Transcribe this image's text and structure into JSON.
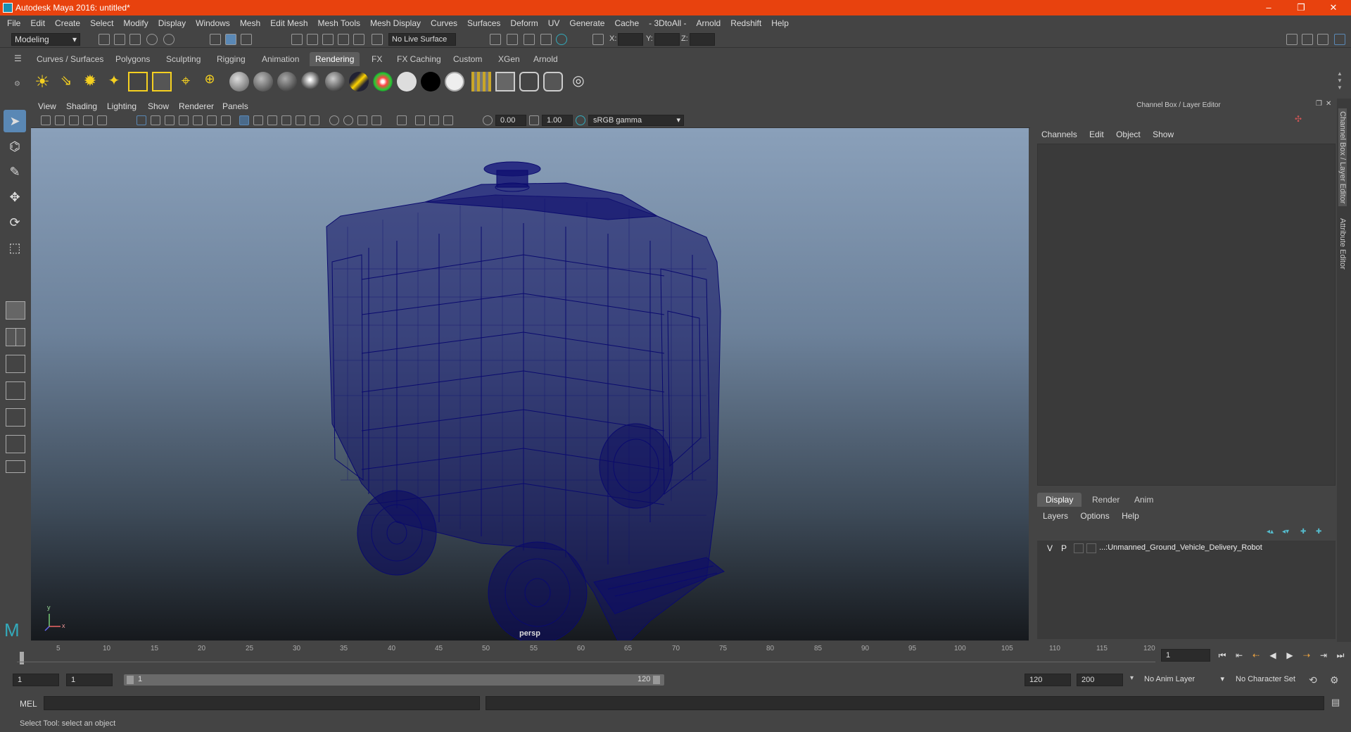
{
  "window": {
    "title": "Autodesk Maya 2016: untitled*",
    "minimize": "–",
    "maximize": "❐",
    "close": "✕"
  },
  "menubar": [
    "File",
    "Edit",
    "Create",
    "Select",
    "Modify",
    "Display",
    "Windows",
    "Mesh",
    "Edit Mesh",
    "Mesh Tools",
    "Mesh Display",
    "Curves",
    "Surfaces",
    "Deform",
    "UV",
    "Generate",
    "Cache",
    "- 3DtoAll -",
    "Arnold",
    "Redshift",
    "Help"
  ],
  "statusline": {
    "menuset": "Modeling",
    "live_surface": "No Live Surface",
    "x_label": "X:",
    "y_label": "Y:",
    "z_label": "Z:"
  },
  "shelf_tabs": [
    "Curves / Surfaces",
    "Polygons",
    "Sculpting",
    "Rigging",
    "Animation",
    "Rendering",
    "FX",
    "FX Caching",
    "Custom",
    "XGen",
    "Arnold"
  ],
  "active_shelf_tab": "Rendering",
  "viewport": {
    "menus": [
      "View",
      "Shading",
      "Lighting",
      "Show",
      "Renderer",
      "Panels"
    ],
    "exposure": "0.00",
    "gamma": "1.00",
    "color_space": "sRGB gamma",
    "camera": "persp",
    "axis_y": "y",
    "axis_x": "x"
  },
  "channel_box": {
    "title": "Channel Box / Layer Editor",
    "menus": [
      "Channels",
      "Edit",
      "Object",
      "Show"
    ]
  },
  "layer_editor": {
    "tabs": [
      "Display",
      "Render",
      "Anim"
    ],
    "active_tab": "Display",
    "menus": [
      "Layers",
      "Options",
      "Help"
    ],
    "layer": {
      "v": "V",
      "p": "P",
      "name": "...:Unmanned_Ground_Vehicle_Delivery_Robot"
    }
  },
  "side_tabs": [
    "Channel Box / Layer Editor",
    "Attribute Editor"
  ],
  "timeline": {
    "ticks": [
      "1",
      "5",
      "10",
      "15",
      "20",
      "25",
      "30",
      "35",
      "40",
      "45",
      "50",
      "55",
      "60",
      "65",
      "70",
      "75",
      "80",
      "85",
      "90",
      "95",
      "100",
      "105",
      "110",
      "115",
      "120"
    ],
    "current_frame": "1"
  },
  "range": {
    "start": "1",
    "anim_start": "1",
    "slider_start": "1",
    "slider_end": "120",
    "playback_end": "120",
    "anim_end": "200",
    "anim_layer": "No Anim Layer",
    "character_set": "No Character Set"
  },
  "command_line": {
    "label": "MEL"
  },
  "help_line": "Select Tool: select an object"
}
